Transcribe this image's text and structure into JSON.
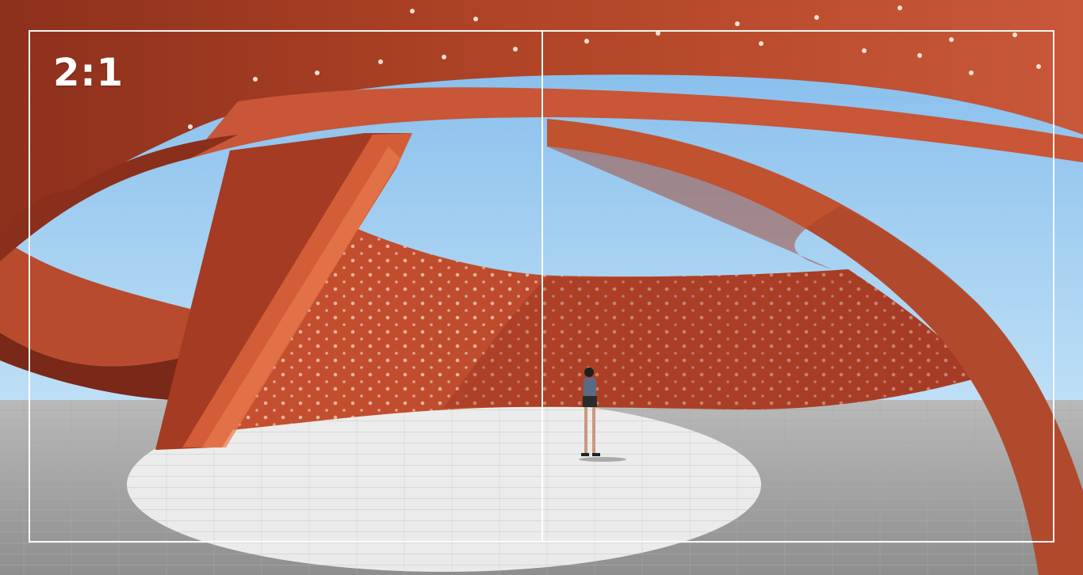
{
  "overlay": {
    "aspect_ratio_label": "2:1"
  },
  "colors": {
    "structure": "#b84a2a",
    "structure_dark": "#7f2b1a",
    "structure_light": "#d6603a",
    "sky": "#8fc6ef",
    "pavement": "#d7d7d7",
    "pavement_shadow": "#9b9b9b",
    "frame_lines": "#ffffff"
  }
}
